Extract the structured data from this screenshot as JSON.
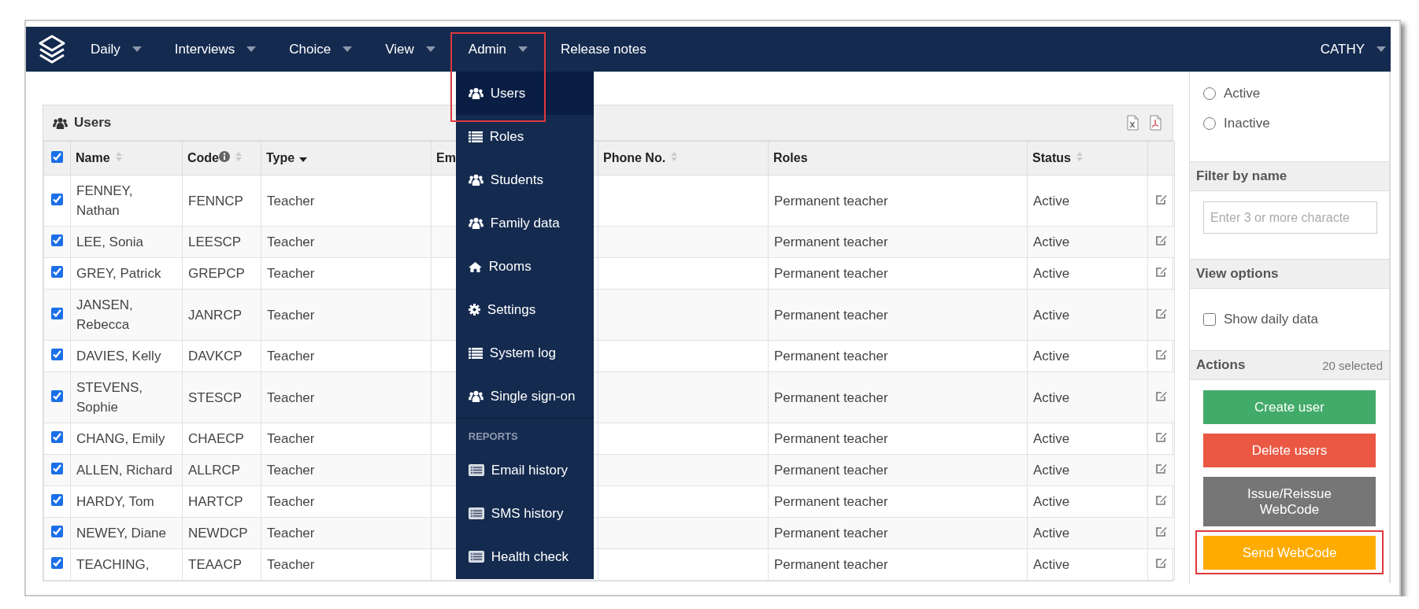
{
  "nav": {
    "items": [
      {
        "label": "Daily",
        "caret": true,
        "expanded": false,
        "highlighted": false
      },
      {
        "label": "Interviews",
        "caret": true,
        "expanded": false,
        "highlighted": false
      },
      {
        "label": "Choice",
        "caret": true,
        "expanded": false,
        "highlighted": false
      },
      {
        "label": "View",
        "caret": true,
        "expanded": false,
        "highlighted": false
      },
      {
        "label": "Admin",
        "caret": true,
        "expanded": true,
        "highlighted": true,
        "menu": {
          "sections": [
            {
              "items": [
                {
                  "label": "Users",
                  "selected": true
                },
                {
                  "label": "Roles",
                  "selected": false
                },
                {
                  "label": "Students",
                  "selected": false
                },
                {
                  "label": "Family data",
                  "selected": false
                },
                {
                  "label": "Rooms",
                  "selected": false
                },
                {
                  "label": "Settings",
                  "selected": false
                },
                {
                  "label": "System log",
                  "selected": false
                },
                {
                  "label": "Single sign-on",
                  "selected": false
                }
              ]
            },
            {
              "heading": "REPORTS",
              "items": [
                {
                  "label": "Email history",
                  "selected": false
                },
                {
                  "label": "SMS history",
                  "selected": false
                },
                {
                  "label": "Health check",
                  "selected": false
                }
              ]
            }
          ]
        }
      },
      {
        "label": "Release notes",
        "caret": false,
        "expanded": false,
        "highlighted": false
      }
    ],
    "user": {
      "label": "CATHY"
    }
  },
  "users_panel": {
    "title": "Users",
    "select_all": {
      "checked": true
    },
    "columns": [
      {
        "label": "Name",
        "sortable": true,
        "sorted": false,
        "info": false
      },
      {
        "label": "Code",
        "sortable": true,
        "sorted": false,
        "info": true
      },
      {
        "label": "Type",
        "sortable": false,
        "sorted": true,
        "info": false
      },
      {
        "label": "Em",
        "sortable": false,
        "sorted": false,
        "info": false
      },
      {
        "label": "Phone No.",
        "sortable": true,
        "sorted": false,
        "info": false
      },
      {
        "label": "Roles",
        "sortable": false,
        "sorted": false,
        "info": false
      },
      {
        "label": "Status",
        "sortable": true,
        "sorted": false,
        "info": false
      }
    ],
    "rows": [
      {
        "checked": true,
        "name": "FENNEY, Nathan",
        "code": "FENNCP",
        "type": "Teacher",
        "roles": "Permanent teacher",
        "status": "Active"
      },
      {
        "checked": true,
        "name": "LEE, Sonia",
        "code": "LEESCP",
        "type": "Teacher",
        "roles": "Permanent teacher",
        "status": "Active"
      },
      {
        "checked": true,
        "name": "GREY, Patrick",
        "code": "GREPCP",
        "type": "Teacher",
        "roles": "Permanent teacher",
        "status": "Active"
      },
      {
        "checked": true,
        "name": "JANSEN, Rebecca",
        "code": "JANRCP",
        "type": "Teacher",
        "roles": "Permanent teacher",
        "status": "Active"
      },
      {
        "checked": true,
        "name": "DAVIES, Kelly",
        "code": "DAVKCP",
        "type": "Teacher",
        "roles": "Permanent teacher",
        "status": "Active"
      },
      {
        "checked": true,
        "name": "STEVENS, Sophie",
        "code": "STESCP",
        "type": "Teacher",
        "roles": "Permanent teacher",
        "status": "Active"
      },
      {
        "checked": true,
        "name": "CHANG, Emily",
        "code": "CHAECP",
        "type": "Teacher",
        "roles": "Permanent teacher",
        "status": "Active"
      },
      {
        "checked": true,
        "name": "ALLEN, Richard",
        "code": "ALLRCP",
        "type": "Teacher",
        "roles": "Permanent teacher",
        "status": "Active"
      },
      {
        "checked": true,
        "name": "HARDY, Tom",
        "code": "HARTCP",
        "type": "Teacher",
        "roles": "Permanent teacher",
        "status": "Active"
      },
      {
        "checked": true,
        "name": "NEWEY, Diane",
        "code": "NEWDCP",
        "type": "Teacher",
        "roles": "Permanent teacher",
        "status": "Active"
      },
      {
        "checked": true,
        "name": "TEACHING,",
        "code": "TEAACP",
        "type": "Teacher",
        "roles": "Permanent teacher",
        "status": "Active"
      }
    ]
  },
  "side_panel": {
    "status_filter": {
      "options": [
        {
          "label": "Active",
          "selected": false
        },
        {
          "label": "Inactive",
          "selected": false
        }
      ]
    },
    "name_filter": {
      "title": "Filter by name",
      "placeholder": "Enter 3 or more characte"
    },
    "view_options": {
      "title": "View options",
      "options": [
        {
          "label": "Show daily data",
          "checked": false
        }
      ]
    },
    "actions": {
      "title": "Actions",
      "count": "20 selected",
      "buttons": [
        {
          "label": "Create user",
          "kind": "success",
          "highlighted": false
        },
        {
          "label": "Delete users",
          "kind": "danger",
          "highlighted": false
        },
        {
          "label": "Issue/Reissue WebCode",
          "kind": "neutral",
          "highlighted": false
        },
        {
          "label": "Send WebCode",
          "kind": "warning",
          "highlighted": true
        }
      ]
    }
  }
}
